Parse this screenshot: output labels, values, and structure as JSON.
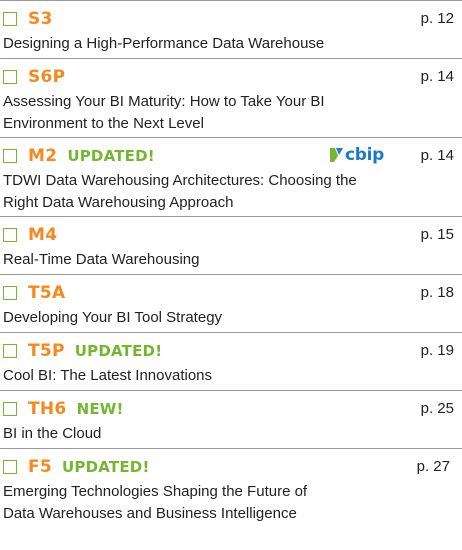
{
  "logo": {
    "text": "cbip",
    "color": "#1f79c8"
  },
  "colors": {
    "code": "#f5891f",
    "badge": "#74b72e",
    "checkbox_border": "#74b72e",
    "divider": "#9a9a9a"
  },
  "courses": [
    {
      "code": "S3",
      "badge": "",
      "page": "p. 12",
      "title_lines": [
        "Designing a High-Performance Data Warehouse"
      ]
    },
    {
      "code": "S6P",
      "badge": "",
      "page": "p. 14",
      "title_lines": [
        "Assessing Your BI Maturity: How to Take Your BI",
        "Environment to the Next Level"
      ]
    },
    {
      "code": "M2",
      "badge": "UPDATED!",
      "page": "p. 14",
      "title_lines": [
        "TDWI Data Warehousing Architectures: Choosing the",
        "Right Data Warehousing Approach"
      ]
    },
    {
      "code": "M4",
      "badge": "",
      "page": "p. 15",
      "title_lines": [
        "Real-Time Data Warehousing"
      ]
    },
    {
      "code": "T5A",
      "badge": "",
      "page": "p. 18",
      "title_lines": [
        "Developing Your BI Tool Strategy"
      ]
    },
    {
      "code": "T5P",
      "badge": "UPDATED!",
      "page": "p. 19",
      "title_lines": [
        "Cool BI: The Latest Innovations"
      ]
    },
    {
      "code": "TH6",
      "badge": "NEW!",
      "page": "p. 25",
      "title_lines": [
        "BI in the Cloud"
      ]
    },
    {
      "code": "F5",
      "badge": "UPDATED!",
      "page": "p. 27",
      "title_lines": [
        "Emerging Technologies Shaping the Future of",
        "Data Warehouses and Business Intelligence"
      ]
    }
  ]
}
